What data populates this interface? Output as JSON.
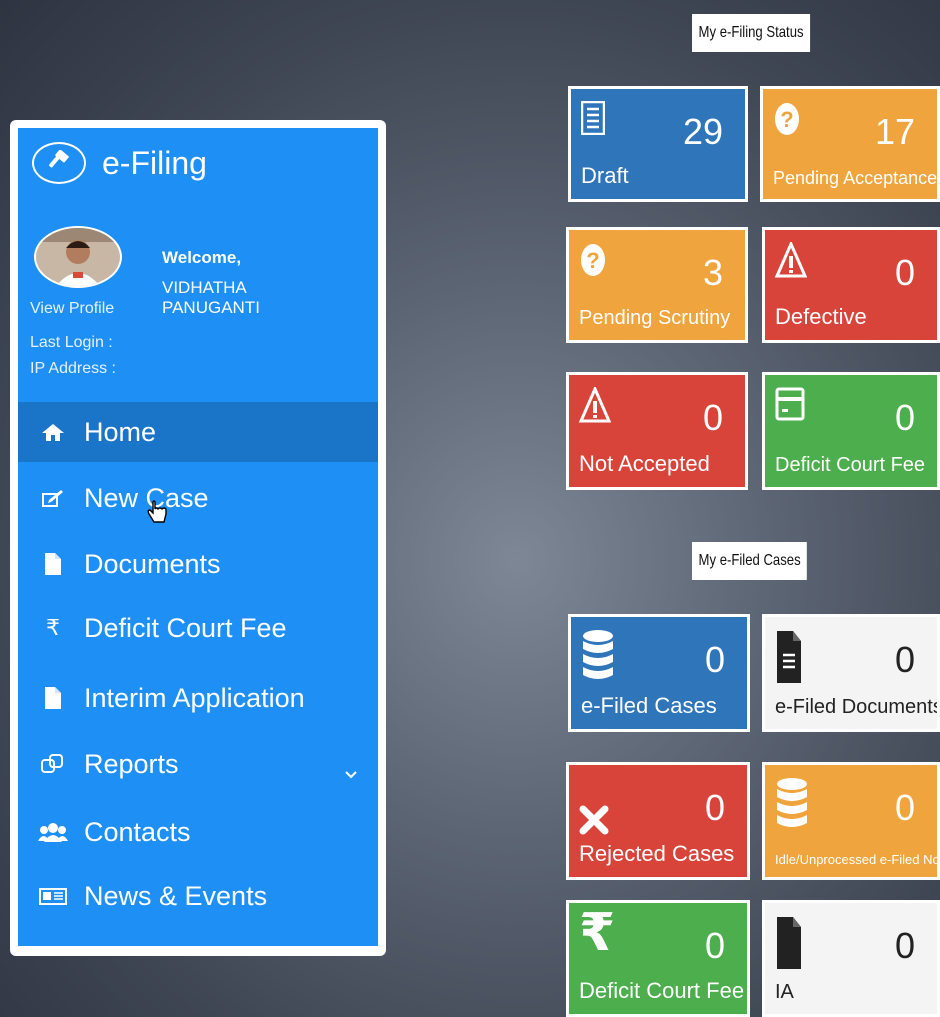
{
  "sidebar": {
    "brand_title": "e-Filing",
    "welcome": "Welcome,",
    "user_name": "VIDHATHA PANUGANTI",
    "view_profile": "View Profile",
    "last_login_label": "Last Login :",
    "ip_address_label": "IP Address :",
    "items": [
      {
        "label": "Home",
        "icon": "home-icon",
        "active": true
      },
      {
        "label": "New Case",
        "icon": "edit-icon"
      },
      {
        "label": "Documents",
        "icon": "file-icon"
      },
      {
        "label": "Deficit Court Fee",
        "icon": "rupee-icon"
      },
      {
        "label": "Interim Application",
        "icon": "file-icon"
      },
      {
        "label": "Reports",
        "icon": "reports-icon",
        "has_submenu": true
      },
      {
        "label": "Contacts",
        "icon": "users-icon"
      },
      {
        "label": "News & Events",
        "icon": "newspaper-icon"
      }
    ]
  },
  "status_section": {
    "title": "My e-Filing Status",
    "tiles": [
      {
        "label": "Draft",
        "count": "29",
        "color": "#2e75ba",
        "icon": "list-icon"
      },
      {
        "label": "Pending Acceptance",
        "count": "17",
        "color": "#efa43d",
        "icon": "question-icon"
      },
      {
        "label": "Pending Scrutiny",
        "count": "3",
        "color": "#efa43d",
        "icon": "question-icon"
      },
      {
        "label": "Defective",
        "count": "0",
        "color": "#d9443a",
        "icon": "warning-icon"
      },
      {
        "label": "Not Accepted",
        "count": "0",
        "color": "#d9443a",
        "icon": "warning-icon"
      },
      {
        "label": "Deficit Court Fee",
        "count": "0",
        "color": "#4cae4c",
        "icon": "calculator-icon"
      }
    ]
  },
  "filed_section": {
    "title": "My e-Filed Cases",
    "tiles": [
      {
        "label": "e-Filed Cases",
        "count": "0",
        "color": "#2e75ba",
        "icon": "database-icon"
      },
      {
        "label": "e-Filed Documents",
        "count": "0",
        "color": "#f4f4f4",
        "icon": "document-icon"
      },
      {
        "label": "Rejected Cases",
        "count": "0",
        "color": "#d9443a",
        "icon": "cross-icon"
      },
      {
        "label": "Idle/Unprocessed e-Filed No.'s",
        "count": "0",
        "color": "#efa43d",
        "icon": "database-icon"
      },
      {
        "label": "Deficit Court Fee",
        "count": "0",
        "color": "#4cae4c",
        "icon": "rupee-icon"
      },
      {
        "label": "IA",
        "count": "0",
        "color": "#f4f4f4",
        "icon": "document-icon"
      }
    ]
  }
}
